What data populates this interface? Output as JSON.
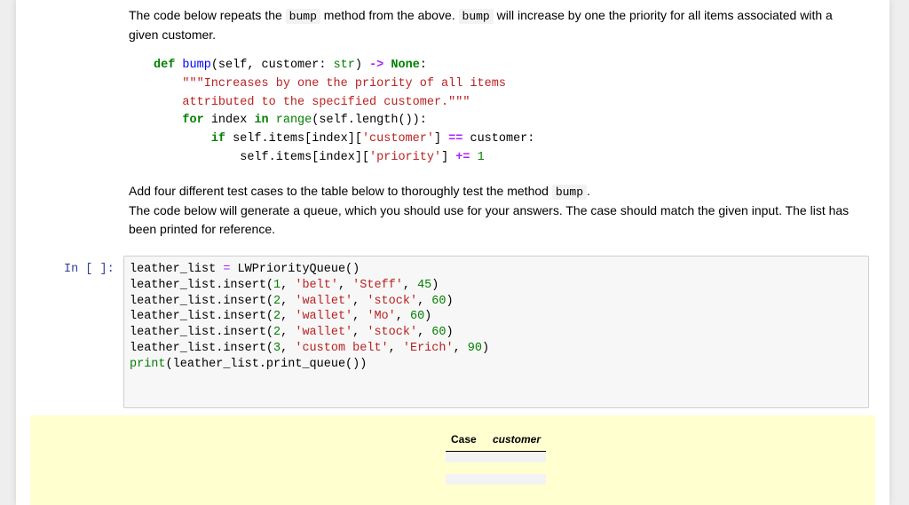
{
  "intro": {
    "part1": "The code below repeats the ",
    "code1": "bump",
    "part2": " method from the above. ",
    "code2": "bump",
    "part3": " will increase by one the priority for all items associated with a given customer."
  },
  "method_code": {
    "line1": {
      "def": "def",
      "name": "bump",
      "args": "(self, customer: ",
      "type": "str",
      "close": ") ",
      "arrow": "->",
      "none": "None",
      "colon": ":"
    },
    "line2": "\"\"\"Increases by one the priority of all items",
    "line3": "attributed to the specified customer.\"\"\"",
    "line4": {
      "for": "for",
      "mid": " index ",
      "in": "in",
      "range": "range",
      "rest": "(self.length()):"
    },
    "line5": {
      "if": "if",
      "a": " self.items[index][",
      "str": "'customer'",
      "b": "] ",
      "eq": "==",
      "c": " customer:"
    },
    "line6": {
      "a": "self.items[index][",
      "str": "'priority'",
      "b": "] ",
      "op": "+=",
      "num": "1"
    }
  },
  "instructions": {
    "line1_text": "Add four different test cases to the table below to thoroughly test the method ",
    "line1_code": "bump",
    "line1_end": ".",
    "line2": "The code below will generate a queue, which you should use for your answers. The case should match the given input. The list has been printed for reference."
  },
  "cell": {
    "prompt": "In [ ]:",
    "lines": [
      {
        "pre": "leather_list ",
        "op": "=",
        "post": " LWPriorityQueue()"
      },
      {
        "call": "leather_list.insert(",
        "n1": "1",
        "s1": "'belt'",
        "s2": "'Steff'",
        "n2": "45"
      },
      {
        "call": "leather_list.insert(",
        "n1": "2",
        "s1": "'wallet'",
        "s2": "'stock'",
        "n2": "60"
      },
      {
        "call": "leather_list.insert(",
        "n1": "2",
        "s1": "'wallet'",
        "s2": "'Mo'",
        "n2": "60"
      },
      {
        "call": "leather_list.insert(",
        "n1": "2",
        "s1": "'wallet'",
        "s2": "'stock'",
        "n2": "60"
      },
      {
        "call": "leather_list.insert(",
        "n1": "3",
        "s1": "'custom belt'",
        "s2": "'Erich'",
        "n2": "90"
      }
    ],
    "print_fn": "print",
    "print_arg": "(leather_list.print_queue())"
  },
  "table": {
    "headers": [
      "Case",
      "customer"
    ]
  }
}
